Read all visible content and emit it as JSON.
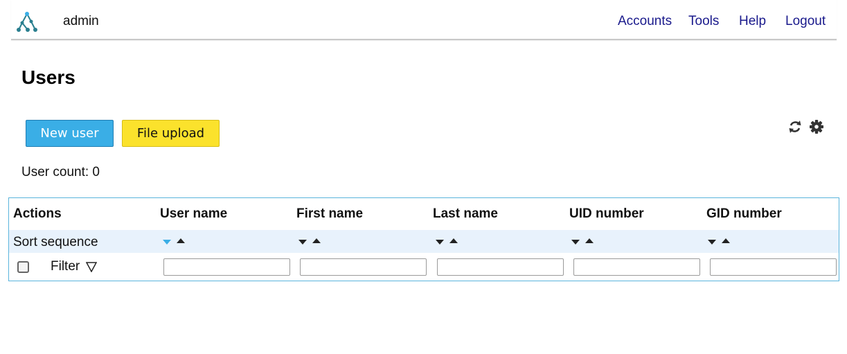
{
  "header": {
    "logo_icon": "tree-network-icon",
    "username": "admin",
    "nav": [
      "Accounts",
      "Tools",
      "Help",
      "Logout"
    ]
  },
  "page": {
    "title": "Users",
    "new_user_label": "New user",
    "file_upload_label": "File upload",
    "icons": [
      "refresh-icon",
      "settings-gear-icon"
    ],
    "user_count_text": "User count: 0"
  },
  "table": {
    "columns": [
      "Actions",
      "User name",
      "First name",
      "Last name",
      "UID number",
      "GID number"
    ],
    "sort_label": "Sort sequence",
    "filter_label": "Filter",
    "active_sort": "User name descending",
    "filter_values": [
      "",
      "",
      "",
      "",
      ""
    ]
  },
  "colors": {
    "new_user_button": "#3aaee6",
    "file_upload_button": "#fbe22c",
    "nav_link": "#1a1a8c",
    "sort_row_bg": "#e8f2fc",
    "table_border": "#5ab4dc"
  }
}
